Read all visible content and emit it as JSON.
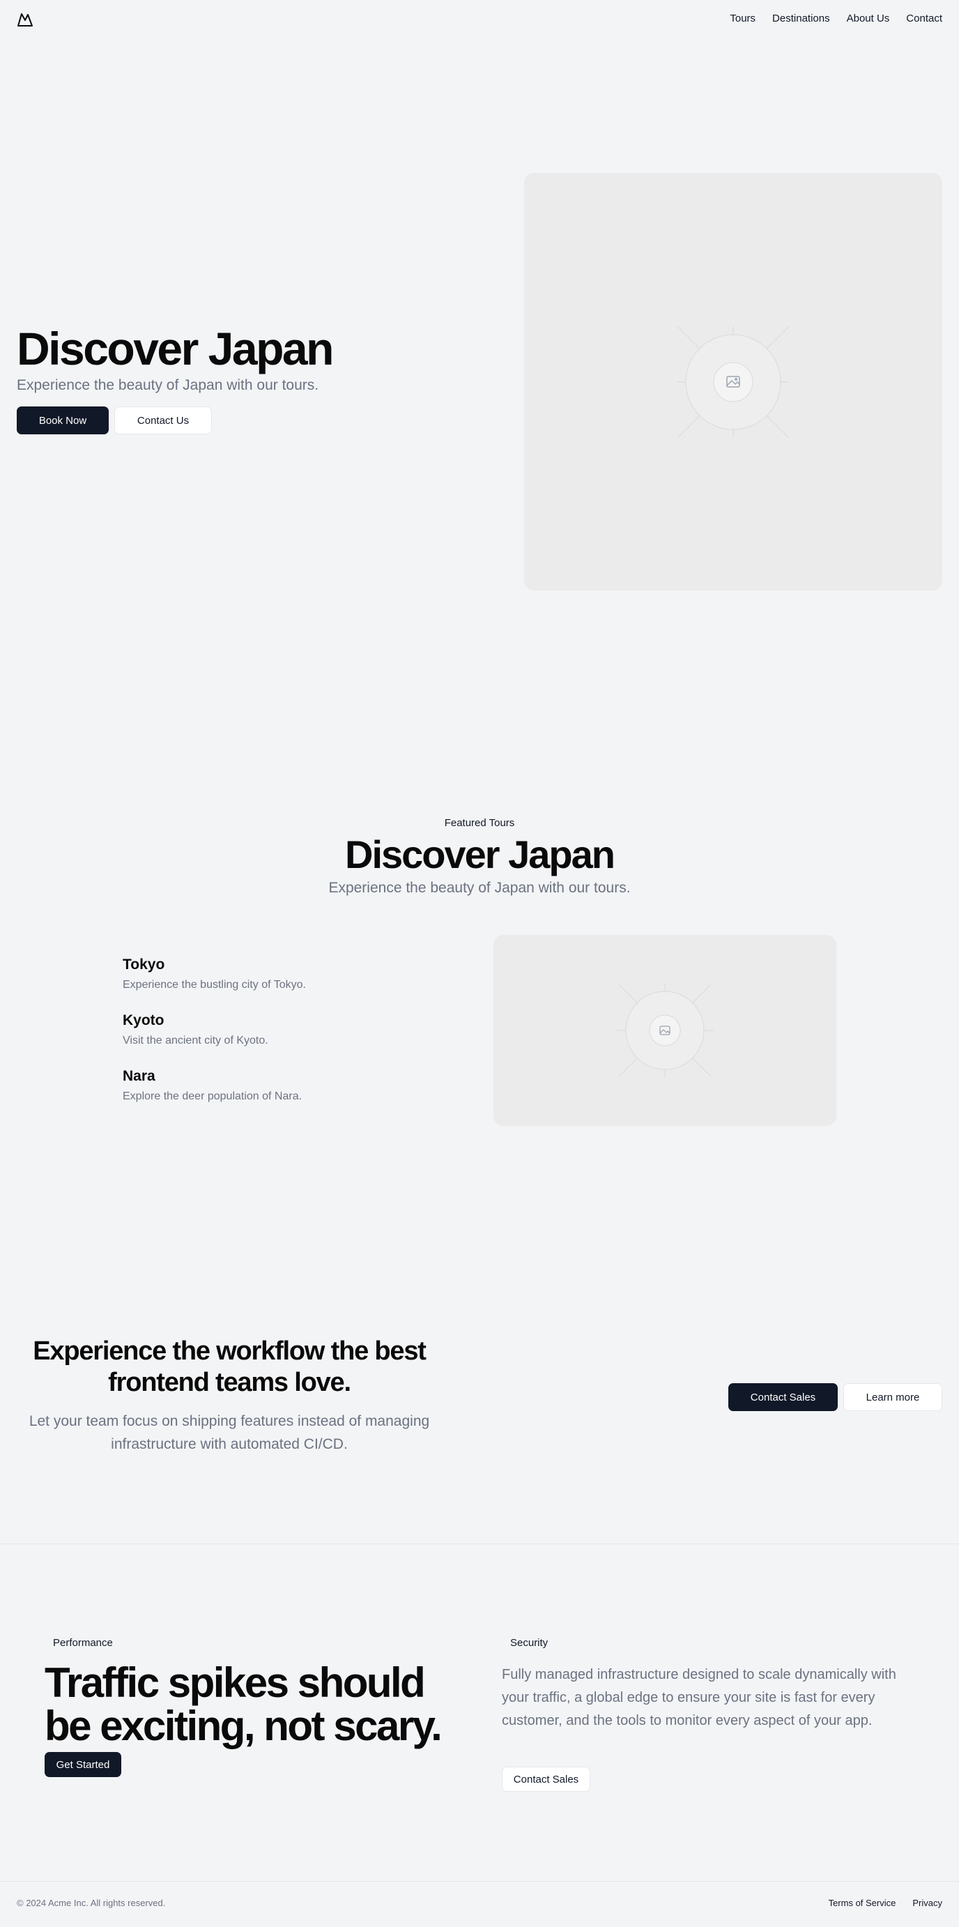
{
  "header": {
    "logo_icon": "mountain-icon",
    "nav": [
      "Tours",
      "Destinations",
      "About Us",
      "Contact"
    ]
  },
  "hero": {
    "title": "Discover Japan",
    "subtitle": "Experience the beauty of Japan with our tours.",
    "primary_button": "Book Now",
    "secondary_button": "Contact Us",
    "image_icon": "image-placeholder-icon"
  },
  "featured": {
    "eyebrow": "Featured Tours",
    "title": "Discover Japan",
    "subtitle": "Experience the beauty of Japan with our tours.",
    "tours": [
      {
        "name": "Tokyo",
        "description": "Experience the bustling city of Tokyo."
      },
      {
        "name": "Kyoto",
        "description": "Visit the ancient city of Kyoto."
      },
      {
        "name": "Nara",
        "description": "Explore the deer population of Nara."
      }
    ]
  },
  "cta": {
    "title": "Experience the workflow the best frontend teams love.",
    "subtitle": "Let your team focus on shipping features instead of managing infrastructure with automated CI/CD.",
    "primary_button": "Contact Sales",
    "secondary_button": "Learn more"
  },
  "features": {
    "performance_label": "Performance",
    "performance_title": "Traffic spikes should be exciting, not scary.",
    "performance_button": "Get Started",
    "security_label": "Security",
    "security_text": "Fully managed infrastructure designed to scale dynamically with your traffic, a global edge to ensure your site is fast for every customer, and the tools to monitor every aspect of your app.",
    "security_button": "Contact Sales"
  },
  "footer": {
    "copyright": "© 2024 Acme Inc. All rights reserved.",
    "links": [
      "Terms of Service",
      "Privacy"
    ]
  },
  "colors": {
    "background": "#f3f4f6",
    "primary": "#111827",
    "muted_text": "#6b7280",
    "placeholder": "#ebebeb"
  }
}
